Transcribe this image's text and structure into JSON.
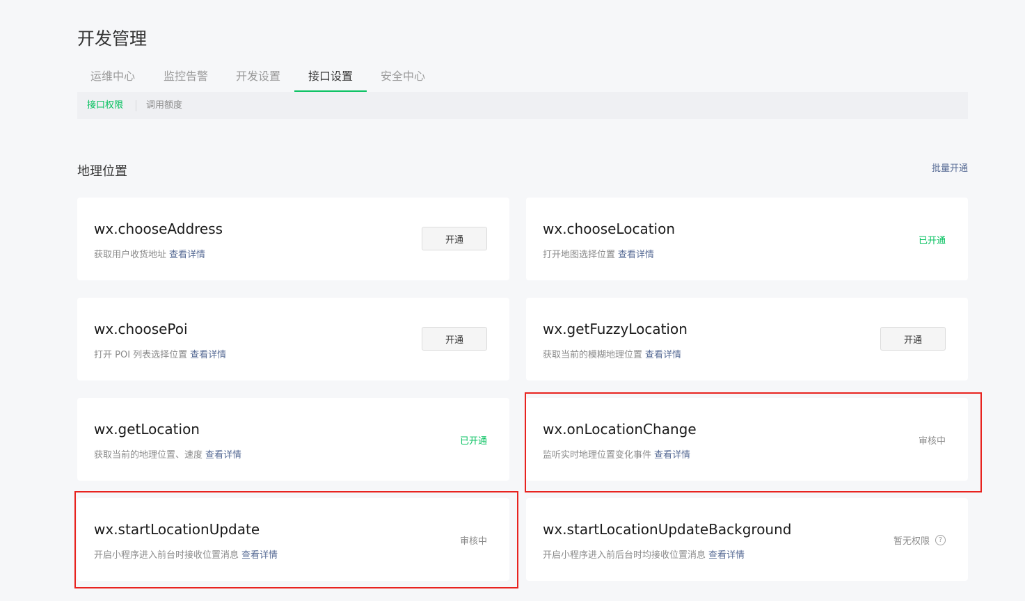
{
  "page": {
    "title": "开发管理"
  },
  "tabs": [
    {
      "label": "运维中心"
    },
    {
      "label": "监控告警"
    },
    {
      "label": "开发设置"
    },
    {
      "label": "接口设置",
      "active": true
    },
    {
      "label": "安全中心"
    }
  ],
  "subnav": [
    {
      "label": "接口权限",
      "active": true
    },
    {
      "label": "调用额度"
    }
  ],
  "section": {
    "title": "地理位置",
    "batch_label": "批量开通"
  },
  "detail_label": "查看详情",
  "cards": [
    {
      "name": "wx.chooseAddress",
      "desc": "获取用户收货地址",
      "action": "开通"
    },
    {
      "name": "wx.chooseLocation",
      "desc": "打开地图选择位置",
      "status": "已开通"
    },
    {
      "name": "wx.choosePoi",
      "desc": "打开 POI 列表选择位置",
      "action": "开通"
    },
    {
      "name": "wx.getFuzzyLocation",
      "desc": "获取当前的模糊地理位置",
      "action": "开通"
    },
    {
      "name": "wx.getLocation",
      "desc": "获取当前的地理位置、速度",
      "status": "已开通"
    },
    {
      "name": "wx.onLocationChange",
      "desc": "监听实时地理位置变化事件",
      "status": "审核中"
    },
    {
      "name": "wx.startLocationUpdate",
      "desc": "开启小程序进入前台时接收位置消息",
      "status": "审核中"
    },
    {
      "name": "wx.startLocationUpdateBackground",
      "desc": "开启小程序进入前后台时均接收位置消息",
      "status": "暂无权限"
    }
  ],
  "colors": {
    "accent_green": "#07c160",
    "link_blue": "#576b95",
    "highlight_red": "#e8231f",
    "background": "#f6f7f9"
  },
  "icons": {
    "help": "question-circle-icon"
  }
}
